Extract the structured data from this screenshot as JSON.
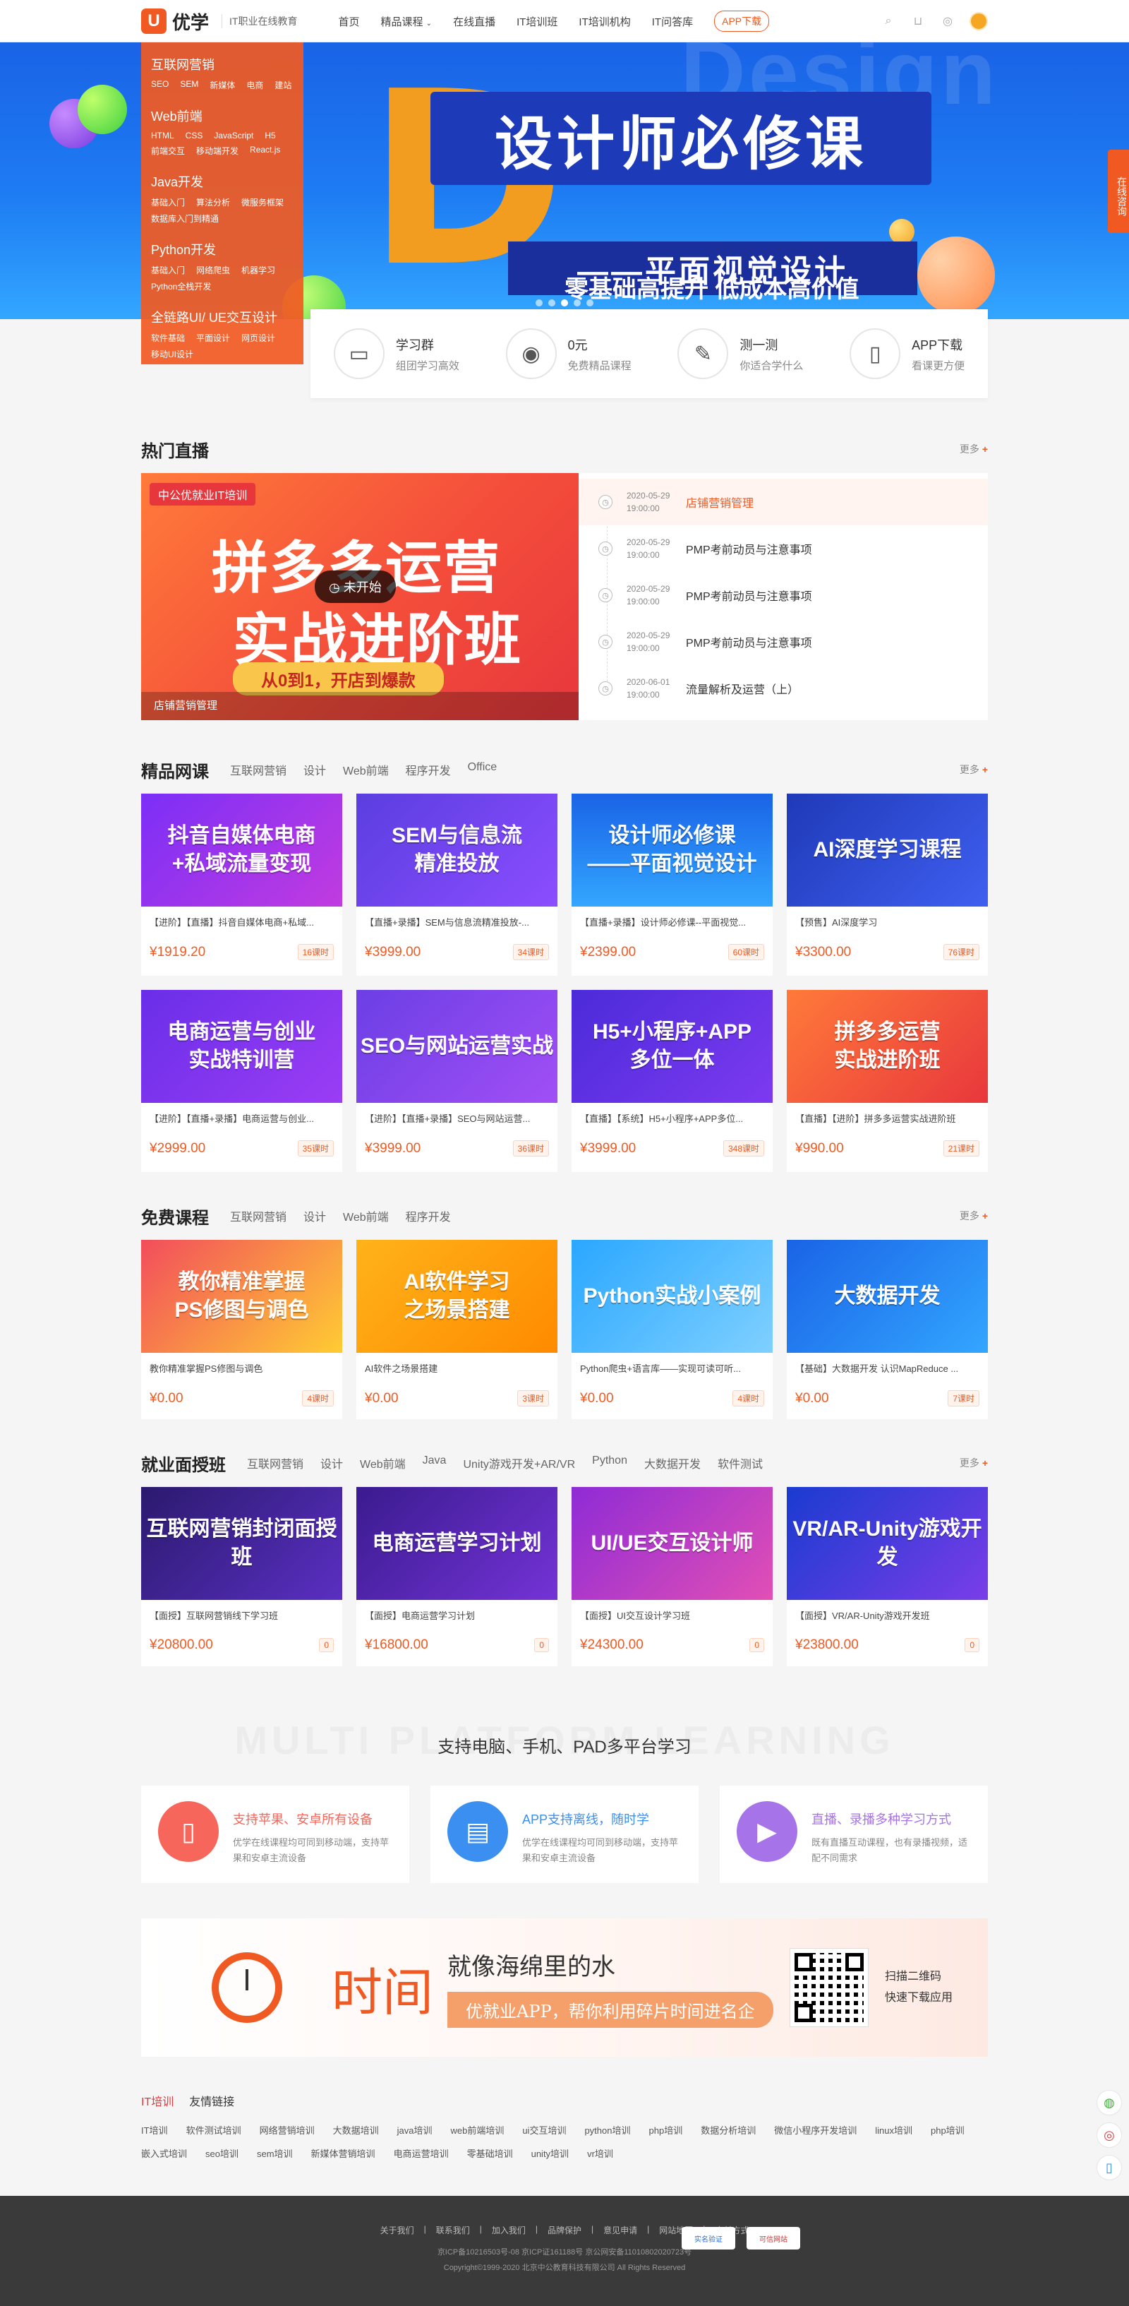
{
  "header": {
    "logo_mark": "U",
    "logo_name": "优学",
    "slogan": "IT职业在线教育",
    "nav": [
      "首页",
      "精品课程",
      "在线直播",
      "IT培训班",
      "IT培训机构",
      "IT问答库"
    ],
    "app_button": "APP下载"
  },
  "banner": {
    "bg_text": "Design",
    "big_letter": "D",
    "title": "设计师必修课",
    "subtitle": "——平面视觉设计",
    "tagline": "零基础高提升  低成本高价值",
    "consult": "在线咨询"
  },
  "categories": [
    {
      "title": "互联网营销",
      "links": [
        "SEO",
        "SEM",
        "新媒体",
        "电商",
        "建站"
      ]
    },
    {
      "title": "Web前端",
      "links": [
        "HTML",
        "CSS",
        "JavaScript",
        "H5",
        "前端交互",
        "移动端开发",
        "React.js"
      ]
    },
    {
      "title": "Java开发",
      "links": [
        "基础入门",
        "算法分析",
        "微服务框架",
        "数据库入门到精通"
      ]
    },
    {
      "title": "Python开发",
      "links": [
        "基础入门",
        "网络爬虫",
        "机器学习",
        "Python全栈开发"
      ]
    },
    {
      "title": "全链路UI/ UE交互设计",
      "links": [
        "软件基础",
        "平面设计",
        "网页设计",
        "移动UI设计"
      ]
    }
  ],
  "quick": [
    {
      "title": "学习群",
      "sub": "组团学习高效",
      "icon": "chat-icon"
    },
    {
      "title": "0元",
      "sub": "免费精品课程",
      "icon": "bulb-icon"
    },
    {
      "title": "测一测",
      "sub": "你适合学什么",
      "icon": "pencil-icon"
    },
    {
      "title": "APP下载",
      "sub": "看课更方便",
      "icon": "phone-icon"
    }
  ],
  "live": {
    "title": "热门直播",
    "more": "更多",
    "banner": {
      "tag": "中公优就业IT培训",
      "line1": "拼多多运营",
      "line2": "实战进阶班",
      "line3": "从0到1，开店到爆款",
      "state": "未开始",
      "caption": "店铺营销管理"
    },
    "items": [
      {
        "date": "2020-05-29",
        "time": "19:00:00",
        "name": "店铺营销管理"
      },
      {
        "date": "2020-05-29",
        "time": "19:00:00",
        "name": "PMP考前动员与注意事项"
      },
      {
        "date": "2020-05-29",
        "time": "19:00:00",
        "name": "PMP考前动员与注意事项"
      },
      {
        "date": "2020-05-29",
        "time": "19:00:00",
        "name": "PMP考前动员与注意事项"
      },
      {
        "date": "2020-06-01",
        "time": "19:00:00",
        "name": "流量解析及运营（上）"
      }
    ]
  },
  "premium": {
    "title": "精品网课",
    "tabs": [
      "互联网营销",
      "设计",
      "Web前端",
      "程序开发",
      "Office"
    ],
    "more": "更多",
    "cards": [
      {
        "thumb": "抖音自媒体电商\n+私域流量变现",
        "name": "【进阶】【直播】抖音自媒体电商+私域...",
        "price": "¥1919.20",
        "hours": "16课时",
        "bg": "linear-gradient(135deg,#7b2ff7,#c13be0)"
      },
      {
        "thumb": "SEM与信息流\n精准投放",
        "name": "【直播+录播】SEM与信息流精准投放-...",
        "price": "¥3999.00",
        "hours": "34课时",
        "bg": "linear-gradient(135deg,#5a3ee0,#8c4dff)"
      },
      {
        "thumb": "设计师必修课\n——平面视觉设计",
        "name": "【直播+录播】设计师必修课--平面视觉...",
        "price": "¥2399.00",
        "hours": "60课时",
        "bg": "linear-gradient(180deg,#1a63e6,#33a6ff)"
      },
      {
        "thumb": "AI深度学习课程",
        "name": "【预售】AI深度学习",
        "price": "¥3300.00",
        "hours": "76课时",
        "bg": "linear-gradient(135deg,#1f3ab8,#3f5ff0)"
      },
      {
        "thumb": "电商运营与创业\n实战特训营",
        "name": "【进阶】【直播+录播】电商运营与创业...",
        "price": "¥2999.00",
        "hours": "35课时",
        "bg": "linear-gradient(135deg,#6a2ee8,#9b3df5)"
      },
      {
        "thumb": "SEO与网站运营实战",
        "name": "【进阶】【直播+录播】SEO与网站运营...",
        "price": "¥3999.00",
        "hours": "36课时",
        "bg": "linear-gradient(135deg,#6b3fe5,#a14ff5)"
      },
      {
        "thumb": "H5+小程序+APP\n多位一体",
        "name": "【直播】【系统】H5+小程序+APP多位...",
        "price": "¥3999.00",
        "hours": "348课时",
        "bg": "linear-gradient(135deg,#4b2bd9,#7d3af0)"
      },
      {
        "thumb": "拼多多运营\n实战进阶班",
        "name": "【直播】【进阶】拼多多运营实战进阶班",
        "price": "¥990.00",
        "hours": "21课时",
        "bg": "linear-gradient(135deg,#ff7a3a,#e8373c)"
      }
    ]
  },
  "free": {
    "title": "免费课程",
    "tabs": [
      "互联网营销",
      "设计",
      "Web前端",
      "程序开发"
    ],
    "more": "更多",
    "cards": [
      {
        "thumb": "教你精准掌握\nPS修图与调色",
        "name": "教你精准掌握PS修图与调色",
        "price": "¥0.00",
        "hours": "4课时",
        "bg": "linear-gradient(135deg,#f24d5c,#ffcc33)"
      },
      {
        "thumb": "AI软件学习\n之场景搭建",
        "name": "AI软件之场景搭建",
        "price": "¥0.00",
        "hours": "3课时",
        "bg": "linear-gradient(135deg,#ffb31a,#ff8a00)"
      },
      {
        "thumb": "Python实战小案例",
        "name": "Python爬虫+语言库——实现可读可听...",
        "price": "¥0.00",
        "hours": "4课时",
        "bg": "linear-gradient(135deg,#2aa7ff,#7fd0ff)"
      },
      {
        "thumb": "大数据开发",
        "name": "【基础】大数据开发 认识MapReduce ...",
        "price": "¥0.00",
        "hours": "7课时",
        "bg": "linear-gradient(135deg,#1a63e6,#33a6ff)"
      }
    ]
  },
  "job": {
    "title": "就业面授班",
    "tabs": [
      "互联网营销",
      "设计",
      "Web前端",
      "Java",
      "Unity游戏开发+AR/VR",
      "Python",
      "大数据开发",
      "软件测试"
    ],
    "more": "更多",
    "cards": [
      {
        "thumb": "互联网营销封闭面授班",
        "name": "【面授】互联网营销线下学习班",
        "price": "¥20800.00",
        "hours": "0",
        "bg": "linear-gradient(135deg,#2b1a6e,#5a2fc2)"
      },
      {
        "thumb": "电商运营学习计划",
        "name": "【面授】电商运营学习计划",
        "price": "¥16800.00",
        "hours": "0",
        "bg": "linear-gradient(135deg,#3a1b8f,#7433d6)"
      },
      {
        "thumb": "UI/UE交互设计师",
        "name": "【面授】UI交互设计学习班",
        "price": "¥24300.00",
        "hours": "0",
        "bg": "linear-gradient(135deg,#8e2bd6,#e24fb5)"
      },
      {
        "thumb": "VR/AR-Unity游戏开发",
        "name": "【面授】VR/AR-Unity游戏开发班",
        "price": "¥23800.00",
        "hours": "0",
        "bg": "linear-gradient(135deg,#1a3bd0,#7a3de8)"
      }
    ]
  },
  "multi": {
    "bg_text": "MULTI PLATFORM LEARNING",
    "title": "支持电脑、手机、PAD多平台学习",
    "items": [
      {
        "title": "支持苹果、安卓所有设备",
        "desc": "优学在线课程均可同到移动端，支持苹果和安卓主流设备",
        "color": "#f6665a",
        "icon": "phone-icon",
        "glyph": "▯"
      },
      {
        "title": "APP支持离线，随时学",
        "desc": "优学在线课程均可同到移动端，支持苹果和安卓主流设备",
        "color": "#3b8ff0",
        "icon": "book-icon",
        "glyph": "▤"
      },
      {
        "title": "直播、录播多种学习方式",
        "desc": "既有直播互动课程，也有录播视频，适配不同需求",
        "color": "#a673e8",
        "icon": "video-icon",
        "glyph": "▶"
      }
    ]
  },
  "app_banner": {
    "big": "时间",
    "s1": "就像海绵里的水",
    "s2": "优就业APP，帮你利用碎片时间进名企",
    "qr_text1": "扫描二维码",
    "qr_text2": "快速下载应用"
  },
  "flinks": {
    "tabs": [
      "IT培训",
      "友情链接"
    ],
    "links": [
      "IT培训",
      "软件测试培训",
      "网络营销培训",
      "大数据培训",
      "java培训",
      "web前端培训",
      "ui交互培训",
      "python培训",
      "php培训",
      "数据分析培训",
      "微信小程序开发培训",
      "linux培训",
      "php培训",
      "嵌入式培训",
      "seo培训",
      "sem培训",
      "新媒体营销培训",
      "电商运营培训",
      "零基础培训",
      "unity培训",
      "vr培训"
    ]
  },
  "footer": {
    "nav": [
      "关于我们",
      "联系我们",
      "加入我们",
      "品牌保护",
      "意见申请",
      "网站地图",
      "支付方式"
    ],
    "icp": "京ICP备10216503号-08  京ICP证161188号      京公网安备11010802020723号",
    "copyright": "Copyright©1999-2020 北京中公教育科技有限公司  All Rights Reserved",
    "badge1": "实名验证",
    "badge2": "可信网站"
  },
  "colors": {
    "accent": "#f05a22",
    "live_highlight": "#fff4ef"
  }
}
